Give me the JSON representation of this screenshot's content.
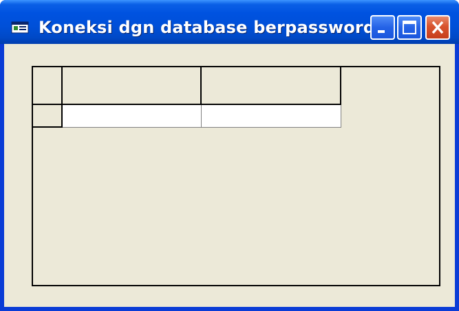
{
  "window": {
    "title": "Koneksi dgn database berpassword",
    "controls": [
      "minimize",
      "maximize",
      "close"
    ]
  },
  "grid": {
    "columns": [
      "",
      ""
    ],
    "rows": [
      [
        "",
        ""
      ]
    ]
  },
  "colors": {
    "titlebar": "#0052e0",
    "client_bg": "#ece9d8",
    "close_button": "#d8532e",
    "grid_line": "#000000"
  },
  "icons": {
    "title_icon": "window-app-icon",
    "minimize": "minimize-icon",
    "maximize": "maximize-icon",
    "close": "close-icon"
  }
}
